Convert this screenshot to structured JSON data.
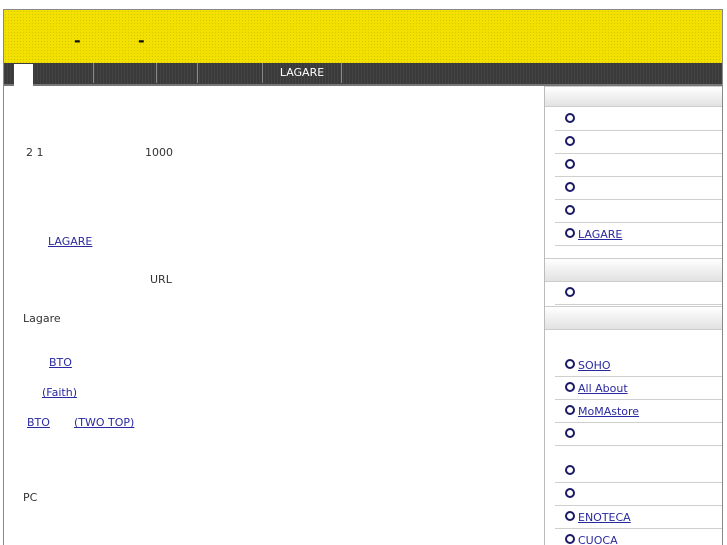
{
  "banner": {
    "marks": [
      "-",
      "-"
    ]
  },
  "nav": {
    "tabs": [
      {
        "label": ""
      },
      {
        "label": ""
      },
      {
        "label": ""
      },
      {
        "label": ""
      },
      {
        "label": "LAGARE"
      }
    ]
  },
  "main": {
    "line1_left": "2 1",
    "line1_right": "1000",
    "url_text": "URL",
    "lagare_text": "Lagare",
    "link_lagare": "LAGARE",
    "link_bto": "BTO",
    "link_faith": "(Faith)",
    "link_bto2": "BTO",
    "link_twotop": "(TWO TOP)",
    "pc_text": "PC"
  },
  "sidebar": {
    "group1": [
      "",
      "",
      "",
      "",
      "",
      "LAGARE"
    ],
    "group2": [
      ""
    ],
    "group3": [
      "SOHO",
      "All About",
      "MoMAstore",
      ""
    ],
    "group4": [
      "",
      "",
      "ENOTECA",
      "CUOCA"
    ]
  }
}
